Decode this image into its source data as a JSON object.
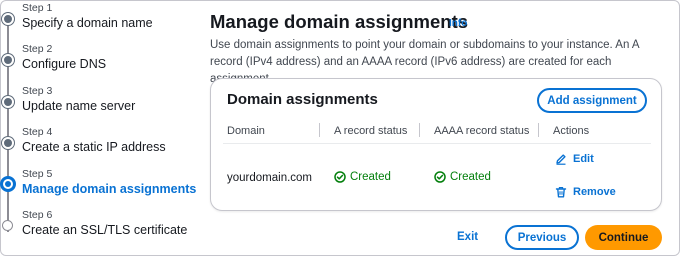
{
  "steps": [
    {
      "number": "Step 1",
      "title": "Specify a domain name",
      "state": "done"
    },
    {
      "number": "Step 2",
      "title": "Configure DNS",
      "state": "done"
    },
    {
      "number": "Step 3",
      "title": "Update name server",
      "state": "done"
    },
    {
      "number": "Step 4",
      "title": "Create a static IP address",
      "state": "done"
    },
    {
      "number": "Step 5",
      "title": "Manage domain assignments",
      "state": "current"
    },
    {
      "number": "Step 6",
      "title": "Create an SSL/TLS certificate",
      "state": "future"
    }
  ],
  "main": {
    "title": "Manage domain assignments",
    "info_label": "Info",
    "description": "Use domain assignments to point your domain or subdomains to your instance. An A record (IPv4 address) and an AAAA record (IPv6 address) are created for each assignment."
  },
  "card": {
    "title": "Domain assignments",
    "add_button": "Add assignment",
    "columns": [
      "Domain",
      "A record status",
      "AAAA record status",
      "Actions"
    ],
    "rows": [
      {
        "domain": "yourdomain.com",
        "a_status": "Created",
        "aaaa_status": "Created",
        "actions": {
          "edit": "Edit",
          "remove": "Remove"
        }
      }
    ]
  },
  "footer": {
    "exit": "Exit",
    "previous": "Previous",
    "continue": "Continue"
  },
  "colors": {
    "accent": "#0972d3",
    "success": "#037f0c",
    "primary_button": "#ff9900"
  },
  "icons": {
    "status": "check-circle-icon",
    "edit": "pencil-icon",
    "remove": "trash-icon"
  }
}
